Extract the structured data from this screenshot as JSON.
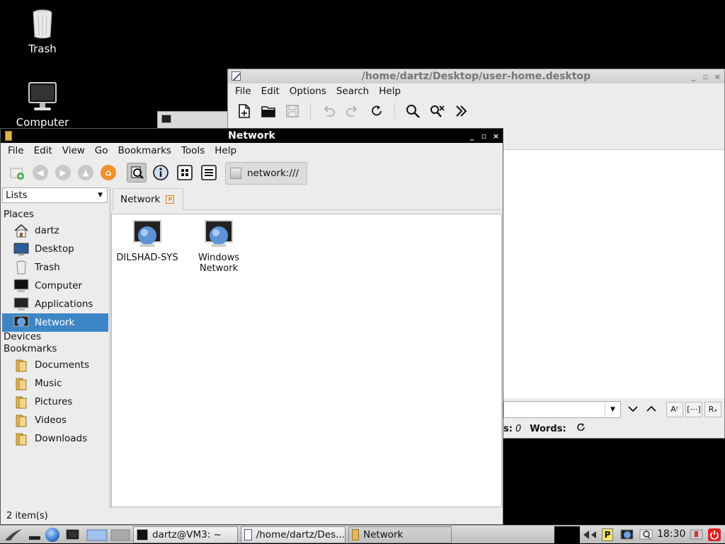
{
  "desktop": {
    "icons": [
      {
        "label": "Trash"
      },
      {
        "label": "Computer"
      }
    ]
  },
  "editor": {
    "title": "/home/dartz/Desktop/user-home.desktop",
    "menu": [
      "File",
      "Edit",
      "Options",
      "Search",
      "Help"
    ],
    "status": {
      "lines_label_partial": "s:",
      "lines_value": "0",
      "words_label": "Words:"
    }
  },
  "filemanager": {
    "title": "Network",
    "menu": [
      "File",
      "Edit",
      "View",
      "Go",
      "Bookmarks",
      "Tools",
      "Help"
    ],
    "location": "network:///",
    "side_combo": "Lists",
    "sections": {
      "places": "Places",
      "devices": "Devices",
      "bookmarks": "Bookmarks"
    },
    "places": [
      {
        "label": "dartz",
        "icon": "home-icon"
      },
      {
        "label": "Desktop",
        "icon": "desktop-icon"
      },
      {
        "label": "Trash",
        "icon": "trash-icon"
      },
      {
        "label": "Computer",
        "icon": "computer-icon"
      },
      {
        "label": "Applications",
        "icon": "applications-icon"
      },
      {
        "label": "Network",
        "icon": "network-icon",
        "selected": true
      }
    ],
    "bookmarks": [
      {
        "label": "Documents"
      },
      {
        "label": "Music"
      },
      {
        "label": "Pictures"
      },
      {
        "label": "Videos"
      },
      {
        "label": "Downloads"
      }
    ],
    "tab": "Network",
    "files": [
      {
        "label": "DILSHAD-SYS"
      },
      {
        "label": "Windows Network"
      }
    ],
    "status": "2 item(s)"
  },
  "taskbar": {
    "tasks": [
      {
        "label": "dartz@VM3: ~"
      },
      {
        "label": "/home/dartz/Des..."
      },
      {
        "label": "Network"
      }
    ],
    "clock": "18:30"
  }
}
